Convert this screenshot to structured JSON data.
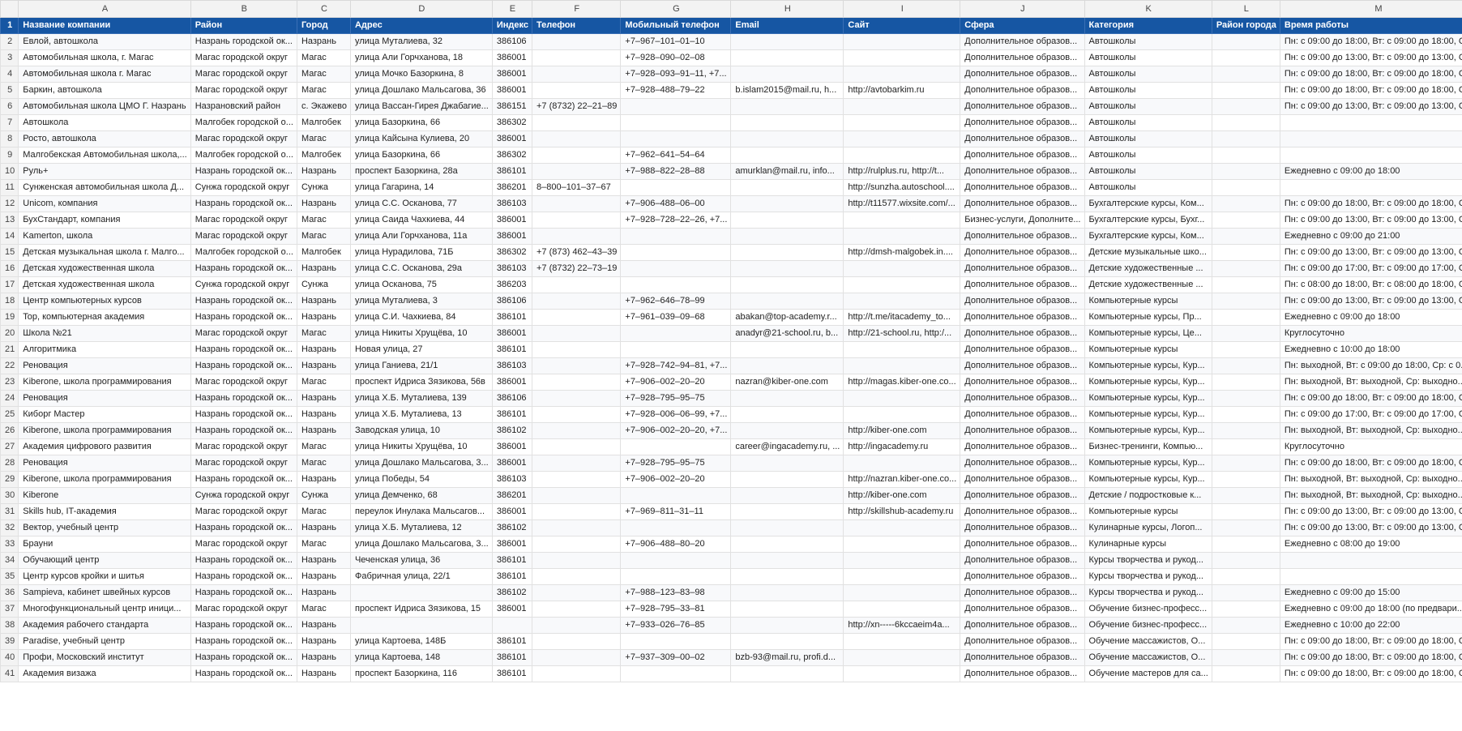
{
  "column_letters": [
    "A",
    "B",
    "C",
    "D",
    "E",
    "F",
    "G",
    "H",
    "I",
    "J",
    "K",
    "L",
    "M"
  ],
  "header_row_number": "1",
  "headers": [
    "Название компании",
    "Район",
    "Город",
    "Адрес",
    "Индекс",
    "Телефон",
    "Мобильный телефон",
    "Email",
    "Сайт",
    "Сфера",
    "Категория",
    "Район города",
    "Время работы"
  ],
  "rows": [
    {
      "n": "2",
      "c": [
        "Евлой, автошкола",
        "Назрань городской ок...",
        "Назрань",
        "улица Муталиева, 32",
        "386106",
        "",
        "+7‒967‒101‒01‒10",
        "",
        "",
        "Дополнительное образов...",
        "Автошколы",
        "",
        "Пн: с 09:00 до 18:00, Вт: с 09:00 до 18:00, С..."
      ]
    },
    {
      "n": "3",
      "c": [
        "Автомобильная школа, г. Магас",
        "Магас городской округ",
        "Магас",
        "улица Али Горчханова, 18",
        "386001",
        "",
        "+7‒928‒090‒02‒08",
        "",
        "",
        "Дополнительное образов...",
        "Автошколы",
        "",
        "Пн: с 09:00 до 13:00, Вт: с 09:00 до 13:00, С..."
      ]
    },
    {
      "n": "4",
      "c": [
        "Автомобильная школа г. Магас",
        "Магас городской округ",
        "Магас",
        "улица Мочко Базоркина, 8",
        "386001",
        "",
        "+7‒928‒093‒91‒11, +7...",
        "",
        "",
        "Дополнительное образов...",
        "Автошколы",
        "",
        "Пн: с 09:00 до 18:00, Вт: с 09:00 до 18:00, С..."
      ]
    },
    {
      "n": "5",
      "c": [
        "Баркин, автошкола",
        "Магас городской округ",
        "Магас",
        "улица Дошлако Мальсагова, 36",
        "386001",
        "",
        "+7‒928‒488‒79‒22",
        "b.islam2015@mail.ru, h...",
        "http://avtobarkim.ru",
        "Дополнительное образов...",
        "Автошколы",
        "",
        "Пн: с 09:00 до 18:00, Вт: с 09:00 до 18:00, С..."
      ]
    },
    {
      "n": "6",
      "c": [
        "Автомобильная школа ЦМО Г. Назрань",
        "Назрановский район",
        "с. Экажево",
        "улица Вассан-Гирея Джабагие...",
        "386151",
        "+7 (8732) 22‒21‒89",
        "",
        "",
        "",
        "Дополнительное образов...",
        "Автошколы",
        "",
        "Пн: с 09:00 до 13:00, Вт: с 09:00 до 13:00, С..."
      ]
    },
    {
      "n": "7",
      "c": [
        "Автошкола",
        "Малгобек городской о...",
        "Малгобек",
        "улица Базоркина, 66",
        "386302",
        "",
        "",
        "",
        "",
        "Дополнительное образов...",
        "Автошколы",
        "",
        ""
      ]
    },
    {
      "n": "8",
      "c": [
        "Росто, автошкола",
        "Магас городской округ",
        "Магас",
        "улица Кайсына Кулиева, 20",
        "386001",
        "",
        "",
        "",
        "",
        "Дополнительное образов...",
        "Автошколы",
        "",
        ""
      ]
    },
    {
      "n": "9",
      "c": [
        "Малгобекская Автомобильная школа,...",
        "Малгобек городской о...",
        "Малгобек",
        "улица Базоркина, 66",
        "386302",
        "",
        "+7‒962‒641‒54‒64",
        "",
        "",
        "Дополнительное образов...",
        "Автошколы",
        "",
        ""
      ]
    },
    {
      "n": "10",
      "c": [
        "Руль+",
        "Назрань городской ок...",
        "Назрань",
        "проспект Базоркина, 28а",
        "386101",
        "",
        "+7‒988‒822‒28‒88",
        "amurklan@mail.ru, info...",
        "http://rulplus.ru, http://t...",
        "Дополнительное образов...",
        "Автошколы",
        "",
        "Ежедневно с 09:00 до 18:00"
      ]
    },
    {
      "n": "11",
      "c": [
        "Сунженская автомобильная школа Д...",
        "Сунжа городской округ",
        "Сунжа",
        "улица Гагарина, 14",
        "386201",
        "8‒800‒101‒37‒67",
        "",
        "",
        "http://sunzha.autoschool....",
        "Дополнительное образов...",
        "Автошколы",
        "",
        ""
      ]
    },
    {
      "n": "12",
      "c": [
        "Unicom, компания",
        "Назрань городской ок...",
        "Назрань",
        "улица С.С. Осканова, 77",
        "386103",
        "",
        "+7‒906‒488‒06‒00",
        "",
        "http://t11577.wixsite.com/...",
        "Дополнительное образов...",
        "Бухгалтерские курсы, Ком...",
        "",
        "Пн: с 09:00 до 18:00, Вт: с 09:00 до 18:00, С..."
      ]
    },
    {
      "n": "13",
      "c": [
        "БухСтандарт, компания",
        "Магас городской округ",
        "Магас",
        "улица Саида Чахкиева, 44",
        "386001",
        "",
        "+7‒928‒728‒22‒26, +7...",
        "",
        "",
        "Бизнес-услуги, Дополните...",
        "Бухгалтерские курсы, Бухг...",
        "",
        "Пн: с 09:00 до 13:00, Вт: с 09:00 до 13:00, С..."
      ]
    },
    {
      "n": "14",
      "c": [
        "Kamerton, школа",
        "Магас городской округ",
        "Магас",
        "улица Али Горчханова, 11а",
        "386001",
        "",
        "",
        "",
        "",
        "Дополнительное образов...",
        "Бухгалтерские курсы, Ком...",
        "",
        "Ежедневно с 09:00 до 21:00"
      ]
    },
    {
      "n": "15",
      "c": [
        "Детская музыкальная школа г. Малго...",
        "Малгобек городской о...",
        "Малгобек",
        "улица Нурадилова, 71Б",
        "386302",
        "+7 (873) 462‒43‒39",
        "",
        "",
        "http://dmsh-malgobek.in....",
        "Дополнительное образов...",
        "Детские музыкальные шко...",
        "",
        "Пн: с 09:00 до 13:00, Вт: с 09:00 до 13:00, С..."
      ]
    },
    {
      "n": "16",
      "c": [
        "Детская художественная школа",
        "Назрань городской ок...",
        "Назрань",
        "улица С.С. Осканова, 29а",
        "386103",
        "+7 (8732) 22‒73‒19",
        "",
        "",
        "",
        "Дополнительное образов...",
        "Детские художественные ...",
        "",
        "Пн: с 09:00 до 17:00, Вт: с 09:00 до 17:00, С..."
      ]
    },
    {
      "n": "17",
      "c": [
        "Детская художественная школа",
        "Сунжа городской округ",
        "Сунжа",
        "улица Осканова, 75",
        "386203",
        "",
        "",
        "",
        "",
        "Дополнительное образов...",
        "Детские художественные ...",
        "",
        "Пн: с 08:00 до 18:00, Вт: с 08:00 до 18:00, С..."
      ]
    },
    {
      "n": "18",
      "c": [
        "Центр компьютерных курсов",
        "Назрань городской ок...",
        "Назрань",
        "улица Муталиева, 3",
        "386106",
        "",
        "+7‒962‒646‒78‒99",
        "",
        "",
        "Дополнительное образов...",
        "Компьютерные курсы",
        "",
        "Пн: с 09:00 до 13:00, Вт: с 09:00 до 13:00, С..."
      ]
    },
    {
      "n": "19",
      "c": [
        "Top, компьютерная академия",
        "Назрань городской ок...",
        "Назрань",
        "улица С.И. Чахкиева, 84",
        "386101",
        "",
        "+7‒961‒039‒09‒68",
        "abakan@top-academy.r...",
        "http://t.me/itacademy_to...",
        "Дополнительное образов...",
        "Компьютерные курсы, Пр...",
        "",
        "Ежедневно с 09:00 до 18:00"
      ]
    },
    {
      "n": "20",
      "c": [
        "Школа №21",
        "Магас городской округ",
        "Магас",
        "улица Никиты Хрущёва, 10",
        "386001",
        "",
        "",
        "anadyr@21-school.ru, b...",
        "http://21-school.ru, http:/...",
        "Дополнительное образов...",
        "Компьютерные курсы, Це...",
        "",
        "Круглосуточно"
      ]
    },
    {
      "n": "21",
      "c": [
        "Алгоритмика",
        "Назрань городской ок...",
        "Назрань",
        "Новая улица, 27",
        "386101",
        "",
        "",
        "",
        "",
        "Дополнительное образов...",
        "Компьютерные курсы",
        "",
        "Ежедневно с 10:00 до 18:00"
      ]
    },
    {
      "n": "22",
      "c": [
        "Реновация",
        "Назрань городской ок...",
        "Назрань",
        "улица Ганиева, 21/1",
        "386103",
        "",
        "+7‒928‒742‒94‒81, +7...",
        "",
        "",
        "Дополнительное образов...",
        "Компьютерные курсы, Кур...",
        "",
        "Пн: выходной, Вт: с 09:00 до 18:00, Ср: с 0..."
      ]
    },
    {
      "n": "23",
      "c": [
        "Kiberone, школа программирования",
        "Магас городской округ",
        "Магас",
        "проспект Идриса Зязикова, 56в",
        "386001",
        "",
        "+7‒906‒002‒20‒20",
        "nazran@kiber-one.com",
        "http://magas.kiber-one.co...",
        "Дополнительное образов...",
        "Компьютерные курсы, Кур...",
        "",
        "Пн: выходной, Вт: выходной, Ср: выходно..."
      ]
    },
    {
      "n": "24",
      "c": [
        "Реновация",
        "Назрань городской ок...",
        "Назрань",
        "улица Х.Б. Муталиева, 139",
        "386106",
        "",
        "+7‒928‒795‒95‒75",
        "",
        "",
        "Дополнительное образов...",
        "Компьютерные курсы, Кур...",
        "",
        "Пн: с 09:00 до 18:00, Вт: с 09:00 до 18:00, С..."
      ]
    },
    {
      "n": "25",
      "c": [
        "Киборг Мастер",
        "Назрань городской ок...",
        "Назрань",
        "улица Х.Б. Муталиева, 13",
        "386101",
        "",
        "+7‒928‒006‒06‒99, +7...",
        "",
        "",
        "Дополнительное образов...",
        "Компьютерные курсы, Кур...",
        "",
        "Пн: с 09:00 до 17:00, Вт: с 09:00 до 17:00, С..."
      ]
    },
    {
      "n": "26",
      "c": [
        "Kiberone, школа программирования",
        "Назрань городской ок...",
        "Назрань",
        "Заводская улица, 10",
        "386102",
        "",
        "+7‒906‒002‒20‒20, +7...",
        "",
        "http://kiber-one.com",
        "Дополнительное образов...",
        "Компьютерные курсы, Кур...",
        "",
        "Пн: выходной, Вт: выходной, Ср: выходно..."
      ]
    },
    {
      "n": "27",
      "c": [
        "Академия цифрового развития",
        "Магас городской округ",
        "Магас",
        "улица Никиты Хрущёва, 10",
        "386001",
        "",
        "",
        "career@ingacademy.ru, ...",
        "http://ingacademy.ru",
        "Дополнительное образов...",
        "Бизнес-тренинги, Компью...",
        "",
        "Круглосуточно"
      ]
    },
    {
      "n": "28",
      "c": [
        "Реновация",
        "Магас городской округ",
        "Магас",
        "улица Дошлако Мальсагова, 3...",
        "386001",
        "",
        "+7‒928‒795‒95‒75",
        "",
        "",
        "Дополнительное образов...",
        "Компьютерные курсы, Кур...",
        "",
        "Пн: с 09:00 до 18:00, Вт: с 09:00 до 18:00, С..."
      ]
    },
    {
      "n": "29",
      "c": [
        "Kiberone, школа программирования",
        "Назрань городской ок...",
        "Назрань",
        "улица Победы, 54",
        "386103",
        "",
        "+7‒906‒002‒20‒20",
        "",
        "http://nazran.kiber-one.co...",
        "Дополнительное образов...",
        "Компьютерные курсы, Кур...",
        "",
        "Пн: выходной, Вт: выходной, Ср: выходно..."
      ]
    },
    {
      "n": "30",
      "c": [
        "Kiberone",
        "Сунжа городской округ",
        "Сунжа",
        "улица Демченко, 68",
        "386201",
        "",
        "",
        "",
        "http://kiber-one.com",
        "Дополнительное образов...",
        "Детские / подростковые к...",
        "",
        "Пн: выходной, Вт: выходной, Ср: выходно..."
      ]
    },
    {
      "n": "31",
      "c": [
        "Skills hub, IT-академия",
        "Магас городской округ",
        "Магас",
        "переулок Инулака Мальсагов...",
        "386001",
        "",
        "+7‒969‒811‒31‒11",
        "",
        "http://skillshub-academy.ru",
        "Дополнительное образов...",
        "Компьютерные курсы",
        "",
        "Пн: с 09:00 до 13:00, Вт: с 09:00 до 13:00, С..."
      ]
    },
    {
      "n": "32",
      "c": [
        "Вектор, учебный центр",
        "Назрань городской ок...",
        "Назрань",
        "улица Х.Б. Муталиева, 12",
        "386102",
        "",
        "",
        "",
        "",
        "Дополнительное образов...",
        "Кулинарные курсы, Логоп...",
        "",
        "Пн: с 09:00 до 13:00, Вт: с 09:00 до 13:00, С..."
      ]
    },
    {
      "n": "33",
      "c": [
        "Брауни",
        "Магас городской округ",
        "Магас",
        "улица Дошлако Мальсагова, 3...",
        "386001",
        "",
        "+7‒906‒488‒80‒20",
        "",
        "",
        "Дополнительное образов...",
        "Кулинарные курсы",
        "",
        "Ежедневно с 08:00 до 19:00"
      ]
    },
    {
      "n": "34",
      "c": [
        "Обучающий центр",
        "Назрань городской ок...",
        "Назрань",
        "Чеченская улица, 36",
        "386101",
        "",
        "",
        "",
        "",
        "Дополнительное образов...",
        "Курсы творчества и рукод...",
        "",
        ""
      ]
    },
    {
      "n": "35",
      "c": [
        "Центр курсов кройки и шитья",
        "Назрань городской ок...",
        "Назрань",
        "Фабричная улица, 22/1",
        "386101",
        "",
        "",
        "",
        "",
        "Дополнительное образов...",
        "Курсы творчества и рукод...",
        "",
        ""
      ]
    },
    {
      "n": "36",
      "c": [
        "Sampieva, кабинет швейных курсов",
        "Назрань городской ок...",
        "Назрань",
        "",
        "386102",
        "",
        "+7‒988‒123‒83‒98",
        "",
        "",
        "Дополнительное образов...",
        "Курсы творчества и рукод...",
        "",
        "Ежедневно с 09:00 до 15:00"
      ]
    },
    {
      "n": "37",
      "c": [
        "Многофункциональный центр иници...",
        "Магас городской округ",
        "Магас",
        "проспект Идриса Зязикова, 15",
        "386001",
        "",
        "+7‒928‒795‒33‒81",
        "",
        "",
        "Дополнительное образов...",
        "Обучение бизнес-професс...",
        "",
        "Ежедневно с 09:00 до 18:00 (по предвари..."
      ]
    },
    {
      "n": "38",
      "c": [
        "Академия рабочего стандарта",
        "Назрань городской ок...",
        "Назрань",
        "",
        "",
        "",
        "+7‒933‒026‒76‒85",
        "",
        "http://xn-----6kccaeim4a...",
        "Дополнительное образов...",
        "Обучение бизнес-професс...",
        "",
        "Ежедневно с 10:00 до 22:00"
      ]
    },
    {
      "n": "39",
      "c": [
        "Paradise, учебный центр",
        "Назрань городской ок...",
        "Назрань",
        "улица Картоева, 148Б",
        "386101",
        "",
        "",
        "",
        "",
        "Дополнительное образов...",
        "Обучение массажистов, О...",
        "",
        "Пн: с 09:00 до 18:00, Вт: с 09:00 до 18:00, С..."
      ]
    },
    {
      "n": "40",
      "c": [
        "Профи, Московский институт",
        "Назрань городской ок...",
        "Назрань",
        "улица Картоева, 148",
        "386101",
        "",
        "+7‒937‒309‒00‒02",
        "bzb-93@mail.ru, profi.d...",
        "",
        "Дополнительное образов...",
        "Обучение массажистов, О...",
        "",
        "Пн: с 09:00 до 18:00, Вт: с 09:00 до 18:00, С..."
      ]
    },
    {
      "n": "41",
      "c": [
        "Академия визажа",
        "Назрань городской ок...",
        "Назрань",
        "проспект Базоркина, 116",
        "386101",
        "",
        "",
        "",
        "",
        "Дополнительное образов...",
        "Обучение мастеров для са...",
        "",
        "Пн: с 09:00 до 18:00, Вт: с 09:00 до 18:00, С..."
      ]
    }
  ]
}
